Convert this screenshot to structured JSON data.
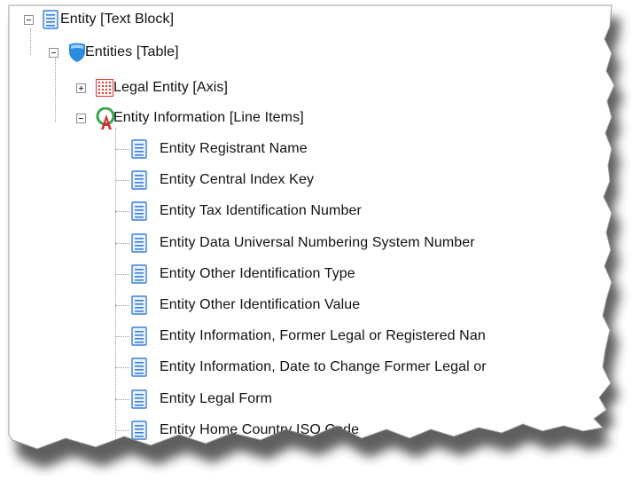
{
  "tree": {
    "nodes": [
      {
        "label": "Entity [Text Block]",
        "icon": "text-block-icon",
        "expander": "minus"
      },
      {
        "label": "Entities [Table]",
        "icon": "table-shield-icon",
        "expander": "minus"
      },
      {
        "label": "Legal Entity [Axis]",
        "icon": "axis-grid-icon",
        "expander": "plus"
      },
      {
        "label": "Entity Information [Line Items]",
        "icon": "line-items-icon",
        "expander": "minus"
      },
      {
        "label": "Entity Registrant Name",
        "icon": "text-block-icon"
      },
      {
        "label": "Entity Central Index Key",
        "icon": "text-block-icon"
      },
      {
        "label": "Entity Tax Identification Number",
        "icon": "text-block-icon"
      },
      {
        "label": "Entity Data Universal Numbering System Number",
        "icon": "text-block-icon"
      },
      {
        "label": "Entity Other Identification Type",
        "icon": "text-block-icon"
      },
      {
        "label": "Entity Other Identification Value",
        "icon": "text-block-icon"
      },
      {
        "label": "Entity Information, Former Legal or Registered Nan",
        "icon": "text-block-icon"
      },
      {
        "label": "Entity Information, Date to Change Former Legal or",
        "icon": "text-block-icon"
      },
      {
        "label": "Entity Legal Form",
        "icon": "text-block-icon"
      },
      {
        "label": "Entity Home Country ISO Code",
        "icon": "text-block-icon"
      }
    ]
  },
  "colors": {
    "doc_icon_blue": "#3a7fd5",
    "shield_blue": "#2d8be0",
    "grid_red": "#e53935",
    "line_items_green": "#3aa64a",
    "line_items_red": "#d32f2f"
  }
}
